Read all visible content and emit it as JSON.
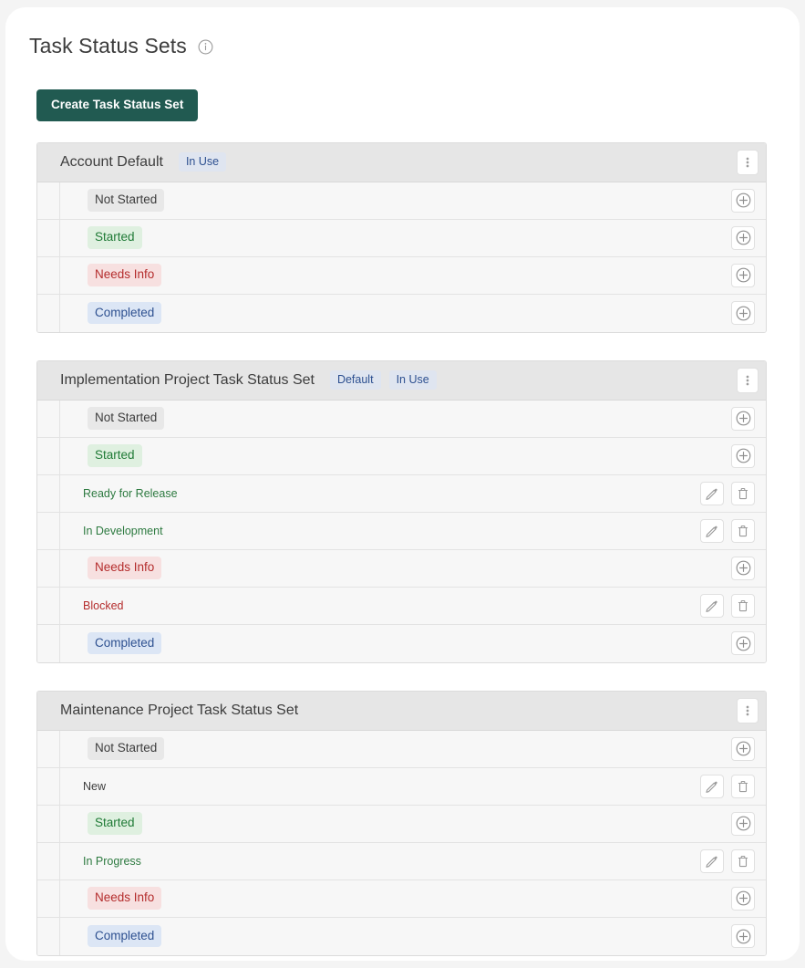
{
  "page": {
    "title": "Task Status Sets",
    "info_icon": "info-circle-icon"
  },
  "toolbar": {
    "create_label": "Create Task Status Set",
    "create_color": "#215a51"
  },
  "icons": {
    "kebab": "more-vertical-icon",
    "add": "plus-circle-icon",
    "edit": "pencil-icon",
    "delete": "trash-icon"
  },
  "colors": {
    "badge_bg": "#dfe5f0",
    "badge_text": "#2d5090",
    "pill_gray_bg": "#e8e8e8",
    "pill_green_bg": "#dff0e0",
    "pill_green_text": "#1f7a36",
    "pill_red_bg": "#f7e0e0",
    "pill_red_text": "#b42c2c",
    "pill_blue_bg": "#dce6f5",
    "pill_blue_text": "#2d5090",
    "card_header_bg": "#e6e6e6",
    "row_bg": "#f7f7f7"
  },
  "status_sets": [
    {
      "name": "Account Default",
      "badges": [
        "In Use"
      ],
      "rows": [
        {
          "label": "Not Started",
          "kind": "parent",
          "tone": "gray",
          "actions": [
            "add"
          ]
        },
        {
          "label": "Started",
          "kind": "parent",
          "tone": "green",
          "actions": [
            "add"
          ]
        },
        {
          "label": "Needs Info",
          "kind": "parent",
          "tone": "red",
          "actions": [
            "add"
          ]
        },
        {
          "label": "Completed",
          "kind": "parent",
          "tone": "blue",
          "actions": [
            "add"
          ]
        }
      ]
    },
    {
      "name": "Implementation Project Task Status Set",
      "badges": [
        "Default",
        "In Use"
      ],
      "rows": [
        {
          "label": "Not Started",
          "kind": "parent",
          "tone": "gray",
          "actions": [
            "add"
          ]
        },
        {
          "label": "Started",
          "kind": "parent",
          "tone": "green",
          "actions": [
            "add"
          ]
        },
        {
          "label": "Ready for Release",
          "kind": "child",
          "tone": "green",
          "actions": [
            "edit",
            "delete"
          ]
        },
        {
          "label": "In Development",
          "kind": "child",
          "tone": "green",
          "actions": [
            "edit",
            "delete"
          ]
        },
        {
          "label": "Needs Info",
          "kind": "parent",
          "tone": "red",
          "actions": [
            "add"
          ]
        },
        {
          "label": "Blocked",
          "kind": "child",
          "tone": "red",
          "actions": [
            "edit",
            "delete"
          ]
        },
        {
          "label": "Completed",
          "kind": "parent",
          "tone": "blue",
          "actions": [
            "add"
          ]
        }
      ]
    },
    {
      "name": "Maintenance Project Task Status Set",
      "badges": [],
      "rows": [
        {
          "label": "Not Started",
          "kind": "parent",
          "tone": "gray",
          "actions": [
            "add"
          ]
        },
        {
          "label": "New",
          "kind": "child",
          "tone": "gray",
          "actions": [
            "edit",
            "delete"
          ]
        },
        {
          "label": "Started",
          "kind": "parent",
          "tone": "green",
          "actions": [
            "add"
          ]
        },
        {
          "label": "In Progress",
          "kind": "child",
          "tone": "green",
          "actions": [
            "edit",
            "delete"
          ]
        },
        {
          "label": "Needs Info",
          "kind": "parent",
          "tone": "red",
          "actions": [
            "add"
          ]
        },
        {
          "label": "Completed",
          "kind": "parent",
          "tone": "blue",
          "actions": [
            "add"
          ]
        }
      ]
    }
  ]
}
